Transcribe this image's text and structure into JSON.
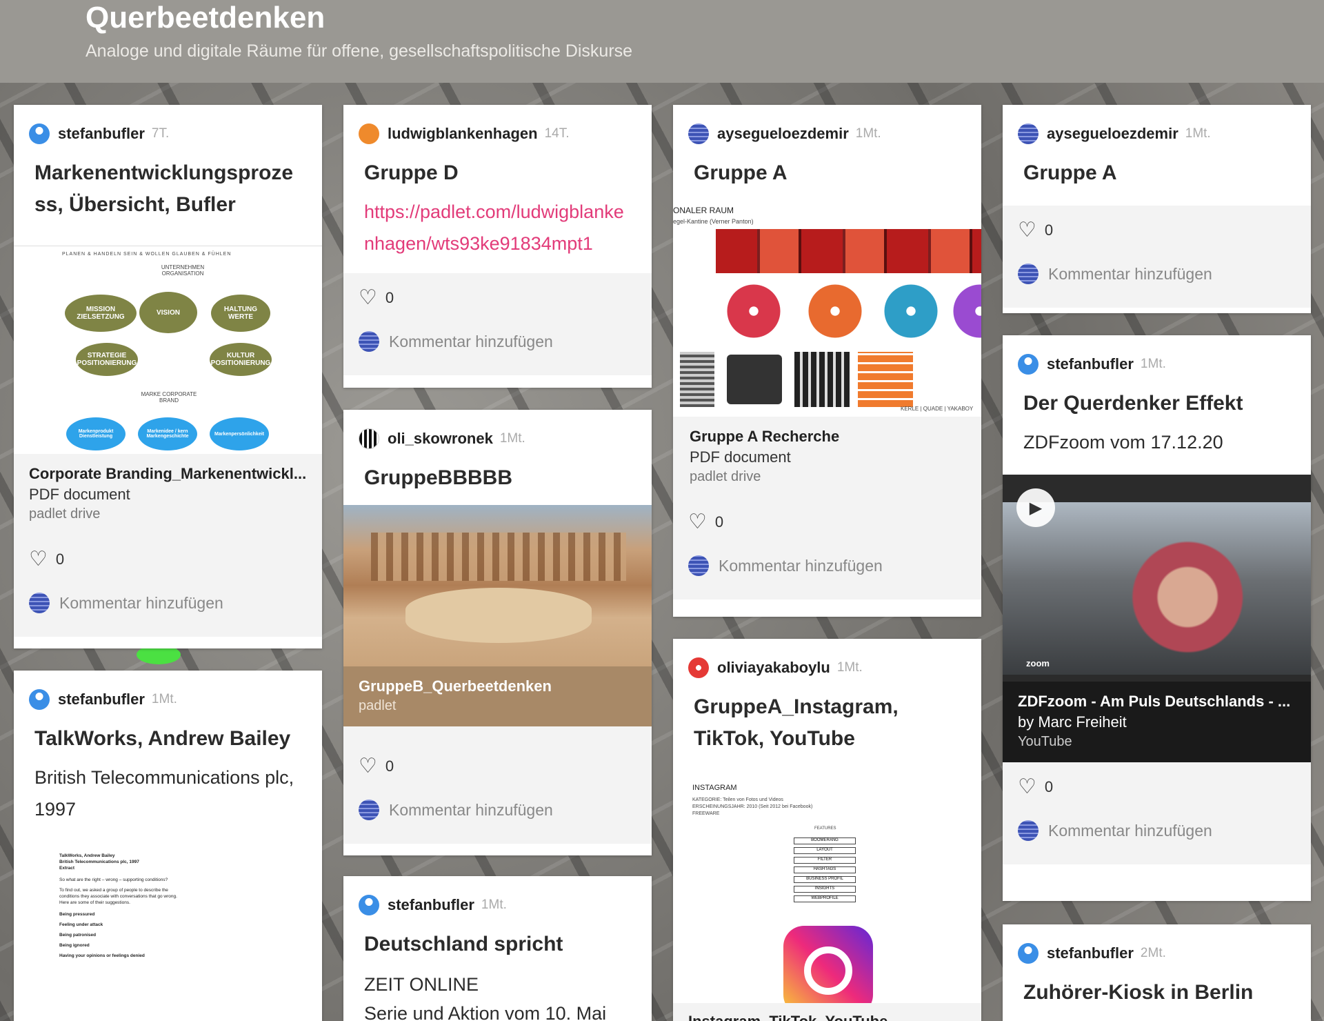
{
  "header": {
    "title": "Querbeetdenken",
    "subtitle": "Analoge und digitale Räume für offene, gesellschaftspolitische Diskurse"
  },
  "common": {
    "comment_placeholder": "Kommentar hinzufügen"
  },
  "cards": [
    {
      "author": "stefanbufler",
      "time": "7T.",
      "title": "Markenentwicklungsprozess, Übersicht, Bufler",
      "attachment": {
        "title": "Corporate Branding_Markenentwickl...",
        "type": "PDF document",
        "source": "padlet drive"
      },
      "diagram": {
        "top_row": "PLANEN & HANDELN       SEIN & WOLLEN       GLAUBEN & FÜHLEN",
        "org": "UNTERNEHMEN ORGANISATION",
        "mission": "MISSION ZIELSETZUNG",
        "vision": "VISION",
        "haltung": "HALTUNG WERTE",
        "strategie": "STRATEGIE POSITIONIERUNG",
        "kultur": "KULTUR POSITIONIERUNG",
        "marke": "MARKE CORPORATE BRAND",
        "b1": "Markenprodukt Dienstleistung",
        "b2": "Markenidee / kern Markengeschichte",
        "b3": "Markenpersönlichkeit"
      },
      "likes": "0"
    },
    {
      "author": "stefanbufler",
      "time": "1Mt.",
      "title": "TalkWorks, Andrew Bailey",
      "body": "British Telecommunications plc, 1997",
      "doc_lines": [
        "TalkWorks, Andrew Bailey",
        "British Telecommunications plc, 1997",
        "Extract",
        "So what are the right – wrong – supporting conditions?",
        "To find out, we asked a group of people to describe the",
        "conditions they associate with conversations that go wrong.",
        "Here are some of their suggestions.",
        "Being pressured",
        "Feeling under attack",
        "Being patronised",
        "Being ignored",
        "Having your opinions or feelings denied"
      ]
    },
    {
      "author": "ludwigblankenhagen",
      "time": "14T.",
      "title": "Gruppe D",
      "link": "https://padlet.com/ludwigblankenhagen/wts93ke91834mpt1",
      "likes": "0"
    },
    {
      "author": "oli_skowronek",
      "time": "1Mt.",
      "title": "GruppeBBBBB",
      "attachment": {
        "title": "GruppeB_Querbeetdenken",
        "source": "padlet"
      },
      "likes": "0"
    },
    {
      "author": "stefanbufler",
      "time": "1Mt.",
      "title": "Deutschland spricht",
      "body": "ZEIT ONLINE",
      "body2": "Serie und Aktion vom 10. Mai"
    },
    {
      "author": "aysegueloezdemir",
      "time": "1Mt.",
      "title": "Gruppe A",
      "doc": {
        "header": "ONALER RAUM",
        "sub": "egel-Kantine (Verner Panton)",
        "footer": "KERLE | QUADE | YAKABOY"
      },
      "attachment": {
        "title": "Gruppe A Recherche",
        "type": "PDF document",
        "source": "padlet drive"
      },
      "likes": "0"
    },
    {
      "author": "oliviayakaboylu",
      "time": "1Mt.",
      "title": "GruppeA_Instagram, TikTok, YouTube",
      "doc": {
        "h": "INSTAGRAM",
        "l1": "KATEGORIE: Teilen von Fotos und Videos",
        "l2": "ERSCHEINUNGSJAHR: 2010 (Seit 2012 bei Facebook)",
        "l3": "FREEWARE",
        "features": "FEATURES",
        "rows": [
          "BOOMERANG",
          "LAYOUT",
          "FILTER",
          "HASHTAGS",
          "BUSINESS PROFIL",
          "INSIGHTS",
          "WEBPROFILE"
        ]
      },
      "attachment": {
        "title": "Instagram_TikTok_YouTube"
      }
    },
    {
      "author": "aysegueloezdemir",
      "time": "1Mt.",
      "title": "Gruppe A",
      "likes": "0"
    },
    {
      "author": "stefanbufler",
      "time": "1Mt.",
      "title": "Der Querdenker Effekt",
      "body": "ZDFzoom vom 17.12.20",
      "video": {
        "logo": "zoom"
      },
      "attachment": {
        "title": "ZDFzoom - Am Puls Deutschlands - ...",
        "type": "by Marc Freiheit",
        "source": "YouTube"
      },
      "likes": "0"
    },
    {
      "author": "stefanbufler",
      "time": "2Mt.",
      "title": "Zuhörer-Kiosk in Berlin"
    }
  ]
}
